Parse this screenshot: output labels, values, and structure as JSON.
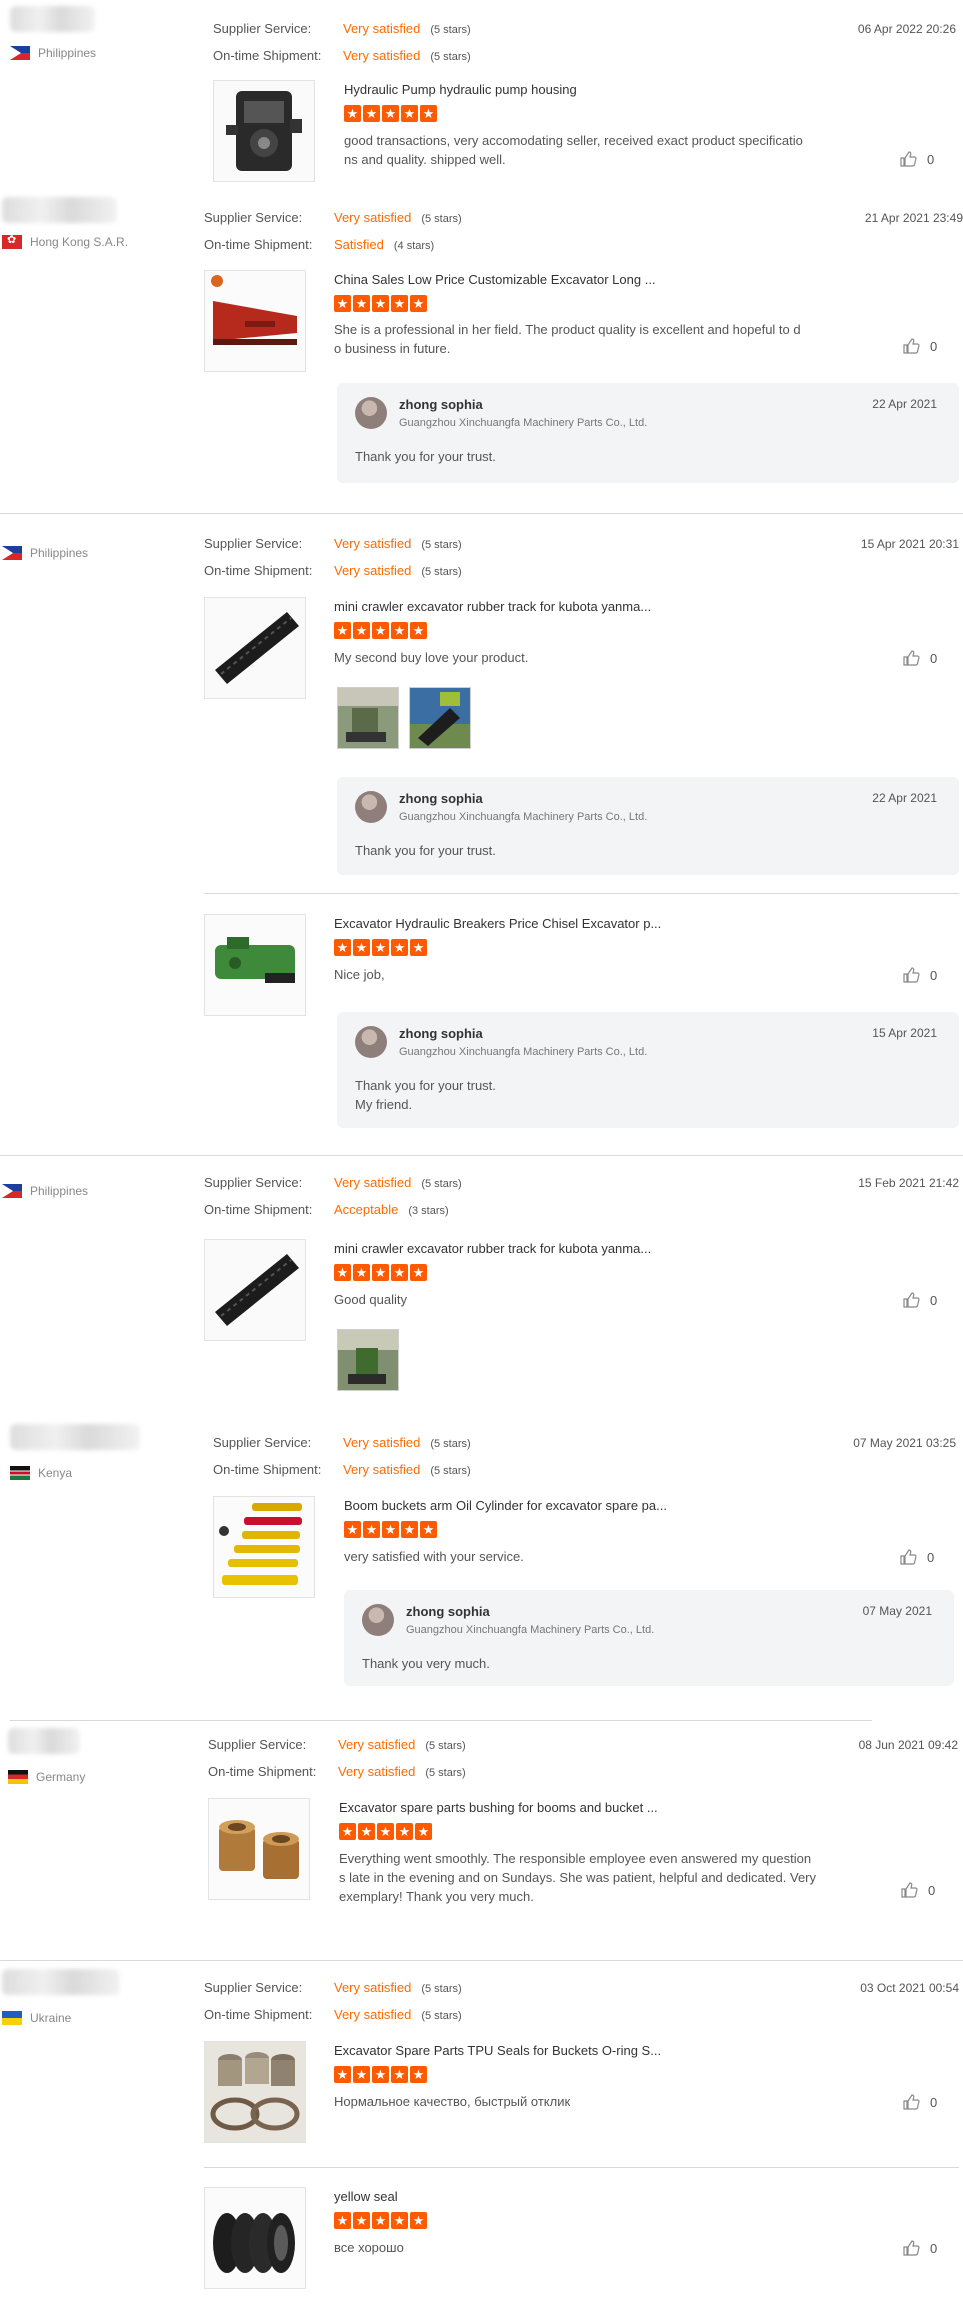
{
  "labels": {
    "supplier_service": "Supplier Service:",
    "ontime_shipment": "On-time Shipment:"
  },
  "reviews": [
    {
      "country": "Philippines",
      "flag": "ph",
      "supplier_rating": "Very satisfied",
      "supplier_stars": "(5 stars)",
      "shipment_rating": "Very satisfied",
      "shipment_stars": "(5 stars)",
      "date": "06 Apr 2022 20:26",
      "items": [
        {
          "product": "Hydraulic Pump hydraulic pump housing",
          "rating": 5,
          "comment": [
            "good transactions, very accomodating seller,  received exact product specificatio",
            "ns and quality. shipped well."
          ],
          "likes": "0"
        }
      ]
    },
    {
      "country": "Hong Kong S.A.R.",
      "flag": "hk",
      "supplier_rating": "Very satisfied",
      "supplier_stars": "(5 stars)",
      "shipment_rating": "Satisfied",
      "shipment_stars": "(4 stars)",
      "date": "21 Apr 2021 23:49",
      "items": [
        {
          "product": "China Sales Low Price Customizable Excavator Long ...",
          "rating": 5,
          "comment": [
            "She is a professional in her field. The product quality is excellent and hopeful to d",
            "o business in future."
          ],
          "likes": "0",
          "reply": {
            "name": "zhong sophia",
            "company": "Guangzhou Xinchuangfa Machinery Parts Co., Ltd.",
            "date": "22 Apr 2021",
            "text": [
              "Thank you for your trust."
            ]
          }
        }
      ]
    },
    {
      "country": "Philippines",
      "flag": "ph",
      "supplier_rating": "Very satisfied",
      "supplier_stars": "(5 stars)",
      "shipment_rating": "Very satisfied",
      "shipment_stars": "(5 stars)",
      "date": "15 Apr 2021 20:31",
      "items": [
        {
          "product": "mini crawler excavator rubber track for kubota yanma...",
          "rating": 5,
          "comment": [
            "My second buy love your product."
          ],
          "likes": "0",
          "photos": 2,
          "reply": {
            "name": "zhong sophia",
            "company": "Guangzhou Xinchuangfa Machinery Parts Co., Ltd.",
            "date": "22 Apr 2021",
            "text": [
              "Thank you for your trust."
            ]
          }
        },
        {
          "product": "Excavator Hydraulic Breakers Price Chisel Excavator p...",
          "rating": 5,
          "comment": [
            "Nice job,"
          ],
          "likes": "0",
          "reply": {
            "name": "zhong sophia",
            "company": "Guangzhou Xinchuangfa Machinery Parts Co., Ltd.",
            "date": "15 Apr 2021",
            "text": [
              "Thank you for your trust.",
              "My friend."
            ]
          }
        }
      ]
    },
    {
      "country": "Philippines",
      "flag": "ph",
      "supplier_rating": "Very satisfied",
      "supplier_stars": "(5 stars)",
      "shipment_rating": "Acceptable",
      "shipment_stars": "(3 stars)",
      "date": "15 Feb 2021 21:42",
      "items": [
        {
          "product": "mini crawler excavator rubber track for kubota yanma...",
          "rating": 5,
          "comment": [
            "Good quality"
          ],
          "likes": "0",
          "photos": 1
        }
      ]
    },
    {
      "country": "Kenya",
      "flag": "ke",
      "supplier_rating": "Very satisfied",
      "supplier_stars": "(5 stars)",
      "shipment_rating": "Very satisfied",
      "shipment_stars": "(5 stars)",
      "date": "07 May 2021 03:25",
      "items": [
        {
          "product": "Boom buckets arm Oil Cylinder for excavator spare pa...",
          "rating": 5,
          "comment": [
            "very satisfied with your service."
          ],
          "likes": "0",
          "reply": {
            "name": "zhong sophia",
            "company": "Guangzhou Xinchuangfa Machinery Parts Co., Ltd.",
            "date": "07 May 2021",
            "text": [
              "Thank you very much."
            ]
          }
        }
      ]
    },
    {
      "country": "Germany",
      "flag": "de",
      "supplier_rating": "Very satisfied",
      "supplier_stars": "(5 stars)",
      "shipment_rating": "Very satisfied",
      "shipment_stars": "(5 stars)",
      "date": "08 Jun 2021 09:42",
      "items": [
        {
          "product": "Excavator spare parts bushing for booms and bucket ...",
          "rating": 5,
          "comment": [
            "Everything went smoothly. The responsible employee even answered my question",
            "s late in the evening and on Sundays. She was patient, helpful and dedicated. Very",
            "exemplary! Thank you very much."
          ],
          "likes": "0"
        }
      ]
    },
    {
      "country": "Ukraine",
      "flag": "ua",
      "supplier_rating": "Very satisfied",
      "supplier_stars": "(5 stars)",
      "shipment_rating": "Very satisfied",
      "shipment_stars": "(5 stars)",
      "date": "03 Oct 2021 00:54",
      "items": [
        {
          "product": "Excavator Spare Parts TPU Seals for Buckets O-ring S...",
          "rating": 5,
          "comment": [
            "Нормальное качество, быстрый отклик"
          ],
          "likes": "0"
        },
        {
          "product": "yellow seal",
          "rating": 5,
          "comment": [
            "все хорошо"
          ],
          "likes": "0"
        }
      ]
    }
  ]
}
